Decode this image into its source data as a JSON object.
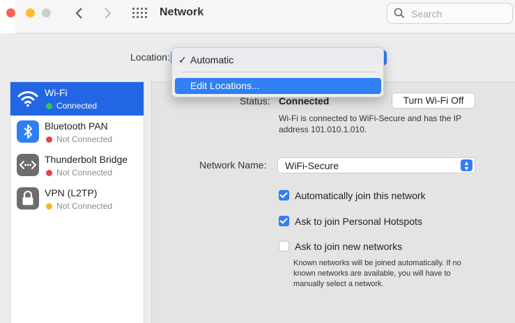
{
  "window": {
    "title": "Network",
    "search_placeholder": "Search"
  },
  "location": {
    "label": "Location:",
    "menu": {
      "checked_item": "Automatic",
      "check_mark": "✓",
      "highlighted_item": "Edit Locations..."
    }
  },
  "sidebar": {
    "services": [
      {
        "name": "Wi-Fi",
        "status": "Connected",
        "status_color": "#2ec84e",
        "icon": "wifi-icon",
        "selected": true
      },
      {
        "name": "Bluetooth PAN",
        "status": "Not Connected",
        "status_color": "#e8433f",
        "icon": "bluetooth-icon",
        "selected": false
      },
      {
        "name": "Thunderbolt Bridge",
        "status": "Not Connected",
        "status_color": "#e8433f",
        "icon": "thunderbolt-bridge-icon",
        "selected": false
      },
      {
        "name": "VPN (L2TP)",
        "status": "Not Connected",
        "status_color": "#f2b81f",
        "icon": "lock-icon",
        "selected": false
      }
    ]
  },
  "detail": {
    "status_label": "Status:",
    "status_value": "Connected",
    "toggle_button": "Turn Wi-Fi Off",
    "status_description": "Wi-Fi is connected to WiFi-Secure and has the IP address 101.010.1.010.",
    "network_name_label": "Network Name:",
    "network_name_value": "WiFi-Secure",
    "options": [
      {
        "label": "Automatically join this network",
        "checked": true
      },
      {
        "label": "Ask to join Personal Hotspots",
        "checked": true
      },
      {
        "label": "Ask to join new networks",
        "checked": false
      }
    ],
    "note": "Known networks will be joined automatically. If no known networks are available, you will have to manually select a network."
  },
  "colors": {
    "accent": "#2f7ff5",
    "selection": "#2266e3"
  }
}
